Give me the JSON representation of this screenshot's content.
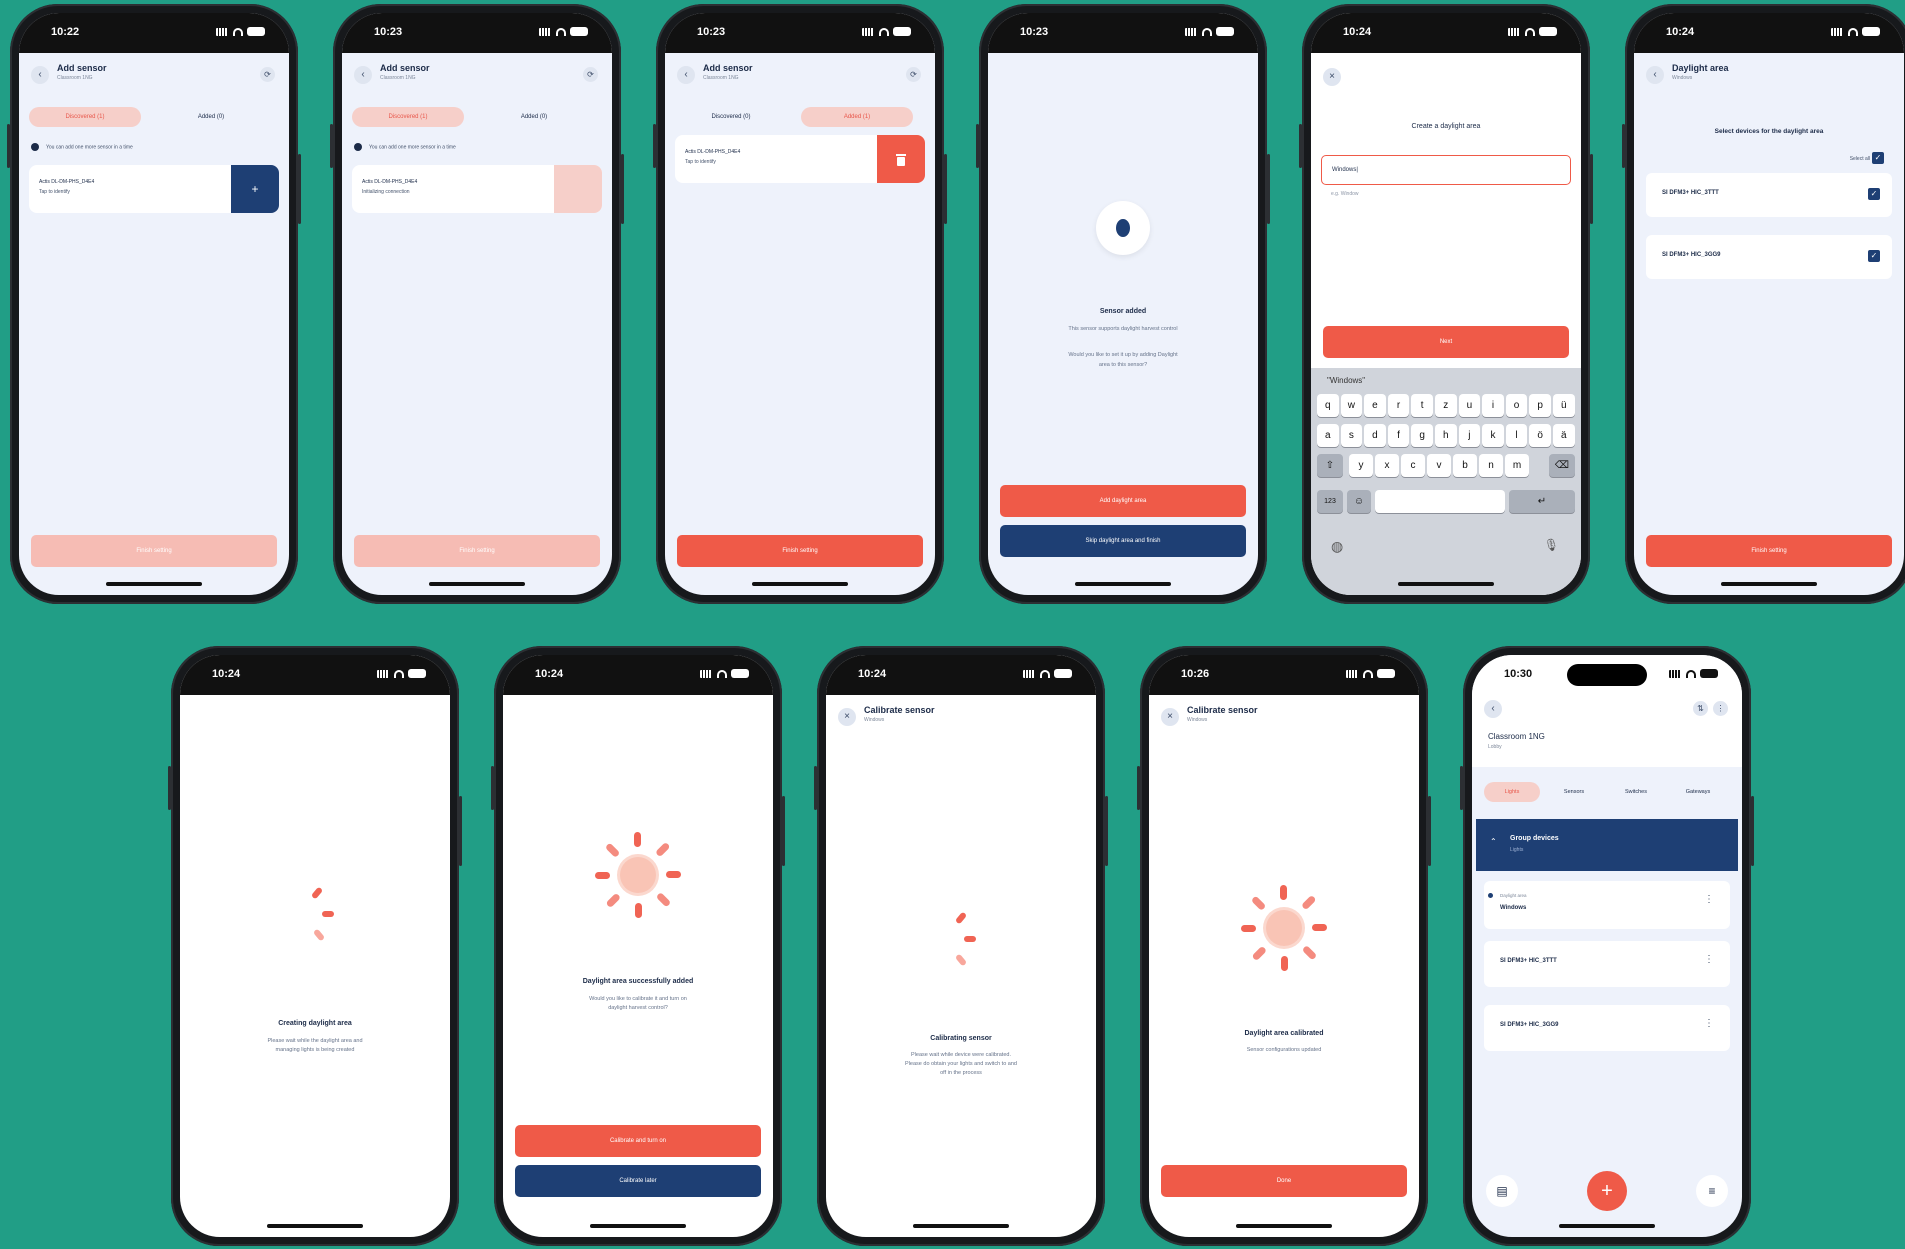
{
  "status": {
    "times": [
      "10:22",
      "10:23",
      "10:23",
      "10:23",
      "10:24",
      "10:24",
      "10:24",
      "10:24",
      "10:24",
      "10:26",
      "10:30"
    ]
  },
  "colors": {
    "background": "#219e86",
    "accent": "#ef5a48",
    "navy": "#1e3f74",
    "screen_bg": "#eef2fb"
  },
  "s1": {
    "title": "Add sensor",
    "subtitle": "Classroom 1NG",
    "tab1": "Discovered (1)",
    "tab2": "Added (0)",
    "info": "You can add one more sensor in a time",
    "dev_name": "Actis DL-DM-PHS_D4E4",
    "dev_status": "Tap to identify",
    "add_icon": "+",
    "button": "Finish setting"
  },
  "s2": {
    "title": "Add sensor",
    "subtitle": "Classroom 1NG",
    "tab1": "Discovered (1)",
    "tab2": "Added (0)",
    "info": "You can add one more sensor in a time",
    "dev_name": "Actis DL-DM-PHS_D4E4",
    "dev_status": "Initializing connection",
    "button": "Finish setting"
  },
  "s3": {
    "title": "Add sensor",
    "subtitle": "Classroom 1NG",
    "tab1": "Discovered (0)",
    "tab2": "Added (1)",
    "dev_name": "Actis DL-DM-PHS_D4E4",
    "dev_status": "Tap to identify",
    "delete_icon": "trash-icon",
    "button": "Finish setting"
  },
  "s4": {
    "heading": "Sensor added",
    "line1": "This sensor supports daylight harvest control",
    "line2": "Would you like to set it up by adding Daylight",
    "line3": "area to this sensor?",
    "primary": "Add daylight area",
    "secondary": "Skip daylight area and finish"
  },
  "s5": {
    "heading": "Create a daylight area",
    "input": "Windows|",
    "hint": "e.g. Window",
    "button": "Next",
    "suggest": "\"Windows\"",
    "row1": [
      "q",
      "w",
      "e",
      "r",
      "t",
      "z",
      "u",
      "i",
      "o",
      "p",
      "ü"
    ],
    "row2": [
      "a",
      "s",
      "d",
      "f",
      "g",
      "h",
      "j",
      "k",
      "l",
      "ö",
      "ä"
    ],
    "row3": [
      "y",
      "x",
      "c",
      "v",
      "b",
      "n",
      "m"
    ],
    "num": "123"
  },
  "s6": {
    "title": "Daylight area",
    "subtitle": "Windows",
    "prompt": "Select devices for the daylight area",
    "select_all": "Select all",
    "dev1": "SI DFM3+ HIC_3TTT",
    "dev2": "SI DFM3+ HIC_3GG9",
    "button": "Finish setting"
  },
  "s7": {
    "heading": "Creating daylight area",
    "line1": "Please wait while the daylight area and",
    "line2": "managing lights is being created"
  },
  "s8": {
    "heading": "Daylight area successfully added",
    "line1": "Would you like to calibrate it and turn on",
    "line2": "daylight harvest control?",
    "primary": "Calibrate and turn on",
    "secondary": "Calibrate later"
  },
  "s9": {
    "title": "Calibrate sensor",
    "subtitle": "Windows",
    "heading": "Calibrating sensor",
    "line1": "Please wait while device were calibrated.",
    "line2": "Please do obtain your lights and switch to and",
    "line3": "off in the process"
  },
  "s10": {
    "title": "Calibrate sensor",
    "subtitle": "Windows",
    "heading": "Daylight area calibrated",
    "line1": "Sensor configurations updated",
    "button": "Done"
  },
  "s11": {
    "title": "Classroom 1NG",
    "subtitle": "Lobby",
    "tabs": [
      "Lights",
      "Sensors",
      "Switches",
      "Gateways"
    ],
    "group": "Group devices",
    "group_sub": "Lights",
    "area_label": "Daylight area",
    "area_name": "Windows",
    "dev1": "SI DFM3+ HIC_3TTT",
    "dev2": "SI DFM3+ HIC_3GG9",
    "fab": "+"
  }
}
